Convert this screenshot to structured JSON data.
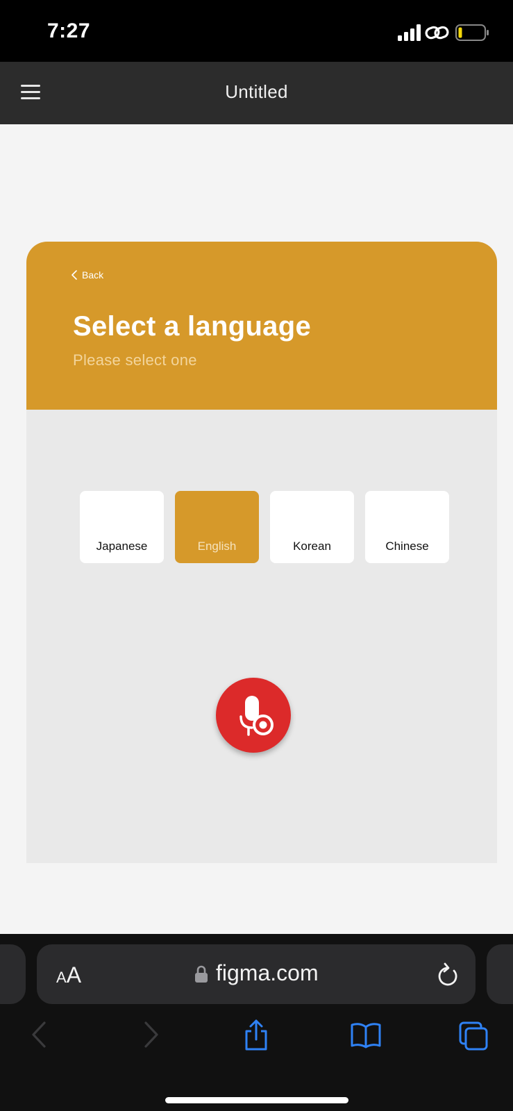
{
  "status_bar": {
    "time": "7:27",
    "icons": [
      "cellular-signal-icon",
      "link-icon",
      "battery-low-icon"
    ]
  },
  "figma_header": {
    "menu_icon": "hamburger-menu-icon",
    "title": "Untitled"
  },
  "frame": {
    "back_label": "Back",
    "title": "Select a language",
    "subtitle": "Please select one",
    "languages": [
      {
        "label": "Japanese",
        "selected": false
      },
      {
        "label": "English",
        "selected": true
      },
      {
        "label": "Korean",
        "selected": false
      },
      {
        "label": "Chinese",
        "selected": false
      }
    ],
    "mic_button_icon": "microphone-record-icon"
  },
  "safari": {
    "text_size_label_small": "A",
    "text_size_label_big": "A",
    "url": "figma.com",
    "icons": [
      "lock-icon",
      "reload-icon",
      "back-arrow-icon",
      "forward-arrow-icon",
      "share-icon",
      "bookmarks-icon",
      "tabs-icon"
    ]
  },
  "colors": {
    "accent": "#d6992a",
    "mic_red": "#dc2a2a",
    "safari_blue": "#2f82f6"
  }
}
